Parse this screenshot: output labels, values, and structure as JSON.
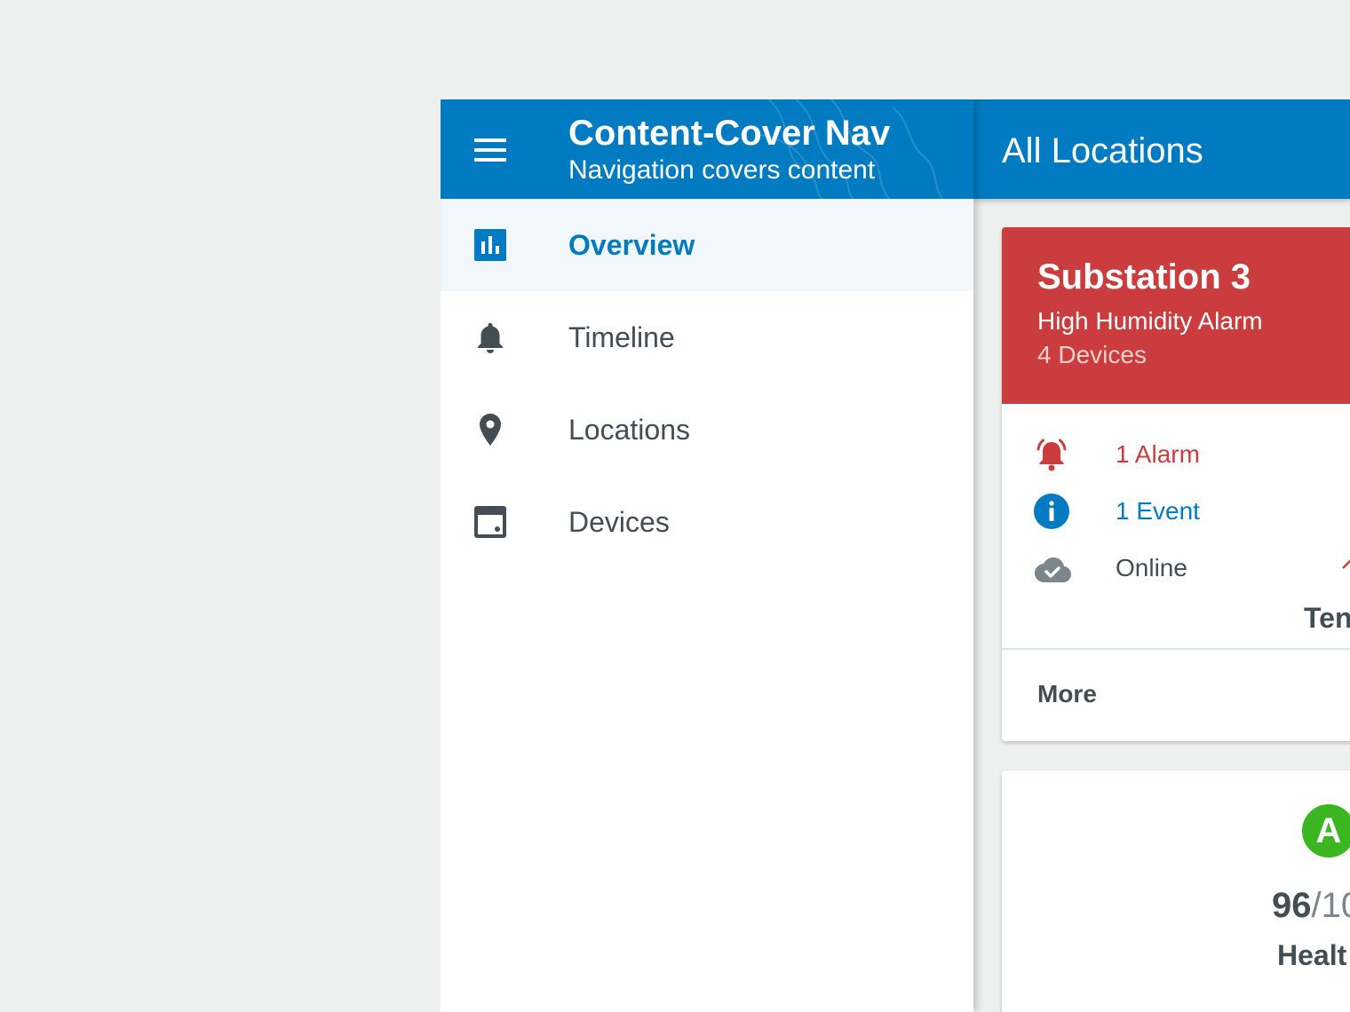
{
  "nav": {
    "title": "Content-Cover Nav",
    "subtitle": "Navigation covers content",
    "items": [
      {
        "label": "Overview",
        "icon": "bar-chart-icon",
        "active": true
      },
      {
        "label": "Timeline",
        "icon": "bell-icon",
        "active": false
      },
      {
        "label": "Locations",
        "icon": "location-pin-icon",
        "active": false
      },
      {
        "label": "Devices",
        "icon": "device-icon",
        "active": false
      }
    ]
  },
  "main": {
    "title": "All Locations",
    "cards": [
      {
        "title": "Substation 3",
        "subtitle": "High Humidity Alarm",
        "devices": "4 Devices",
        "stats": [
          {
            "label": "1 Alarm",
            "icon": "alarm-bell-icon"
          },
          {
            "label": "1 Event",
            "icon": "info-icon"
          },
          {
            "label": "Online",
            "icon": "cloud-check-icon"
          }
        ],
        "trend_partial_label": "Ten",
        "more_label": "More"
      },
      {
        "grade": "A",
        "score": "96",
        "score_suffix": "/10",
        "health_label": "Healt"
      }
    ]
  },
  "colors": {
    "primary": "#007bc1",
    "alarm": "#ca3c3d",
    "text": "#424e54",
    "grade": "#39b620",
    "background": "#eef0ef"
  }
}
